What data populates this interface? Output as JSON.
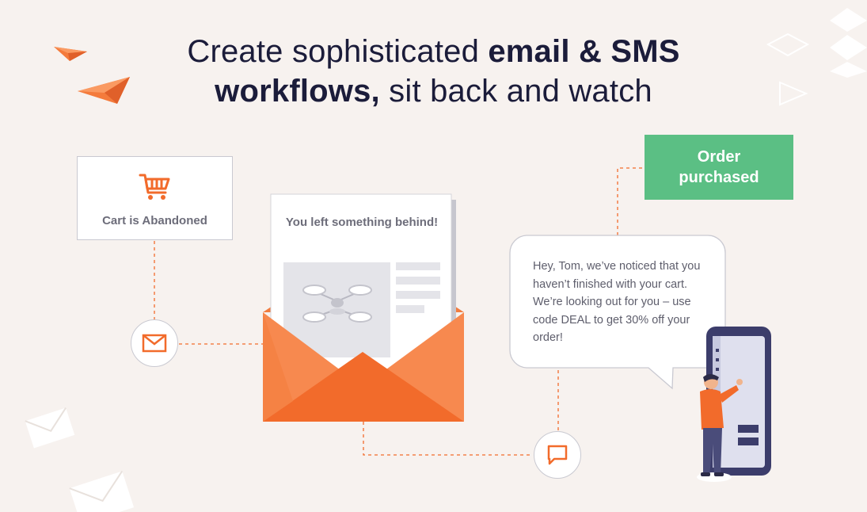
{
  "headline": {
    "line1_plain": "Create sophisticated ",
    "line1_bold": "email & SMS",
    "line2_bold": "workflows,",
    "line2_plain": " sit back and watch"
  },
  "trigger": {
    "label": "Cart is Abandoned",
    "icon": "shopping-cart-icon"
  },
  "email": {
    "title": "You left something behind!",
    "icon": "mail-icon"
  },
  "sms": {
    "message": "Hey, Tom, we’ve noticed that you haven’t finished with your cart. We’re looking out for you – use code DEAL to get 30% off your order!",
    "icon": "chat-bubble-icon"
  },
  "goal": {
    "label": "Order purchased"
  },
  "colors": {
    "background": "#f7f2ef",
    "accent_orange": "#f26b2b",
    "success_green": "#5bbf84",
    "heading": "#1b1c3a",
    "muted_text": "#6d6d7a"
  }
}
